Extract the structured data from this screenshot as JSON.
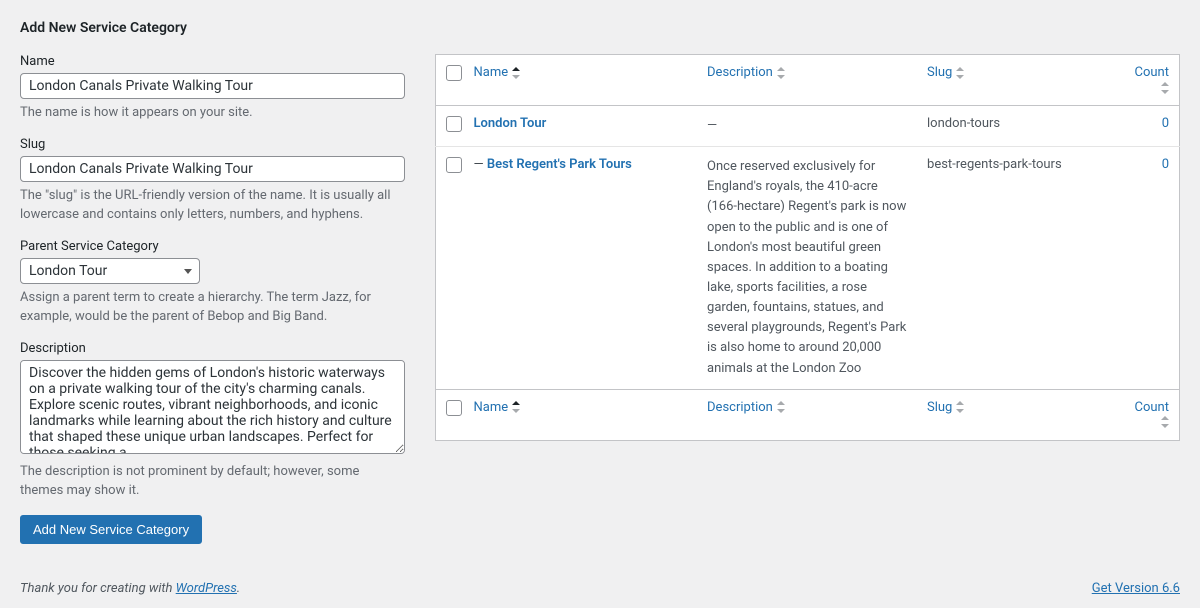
{
  "page_title": "Add New Service Category",
  "form": {
    "name": {
      "label": "Name",
      "value": "London Canals Private Walking Tour",
      "help": "The name is how it appears on your site."
    },
    "slug": {
      "label": "Slug",
      "value": "London Canals Private Walking Tour",
      "help": "The \"slug\" is the URL-friendly version of the name. It is usually all lowercase and contains only letters, numbers, and hyphens."
    },
    "parent": {
      "label": "Parent Service Category",
      "selected": "London Tour",
      "help": "Assign a parent term to create a hierarchy. The term Jazz, for example, would be the parent of Bebop and Big Band."
    },
    "description": {
      "label": "Description",
      "value": "Discover the hidden gems of London's historic waterways on a private walking tour of the city's charming canals. Explore scenic routes, vibrant neighborhoods, and iconic landmarks while learning about the rich history and culture that shaped these unique urban landscapes. Perfect for those seeking a",
      "help": "The description is not prominent by default; however, some themes may show it."
    },
    "submit_label": "Add New Service Category"
  },
  "table": {
    "columns": {
      "name": "Name",
      "description": "Description",
      "slug": "Slug",
      "count": "Count"
    },
    "rows": [
      {
        "name": "London Tour",
        "prefix": "",
        "description": "—",
        "slug": "london-tours",
        "count": "0"
      },
      {
        "name": "Best Regent's Park Tours",
        "prefix": "— ",
        "description": "Once reserved exclusively for England's royals, the 410-acre (166-hectare) Regent's park is now open to the public and is one of London's most beautiful green spaces. In addition to a boating lake, sports facilities, a rose garden, fountains, statues, and several playgrounds, Regent's Park is also home to around 20,000 animals at the London Zoo",
        "slug": "best-regents-park-tours",
        "count": "0"
      }
    ]
  },
  "footer": {
    "thanks_pre": "Thank you for creating with ",
    "thanks_link": "WordPress",
    "thanks_post": ".",
    "version": "Get Version 6.6"
  }
}
